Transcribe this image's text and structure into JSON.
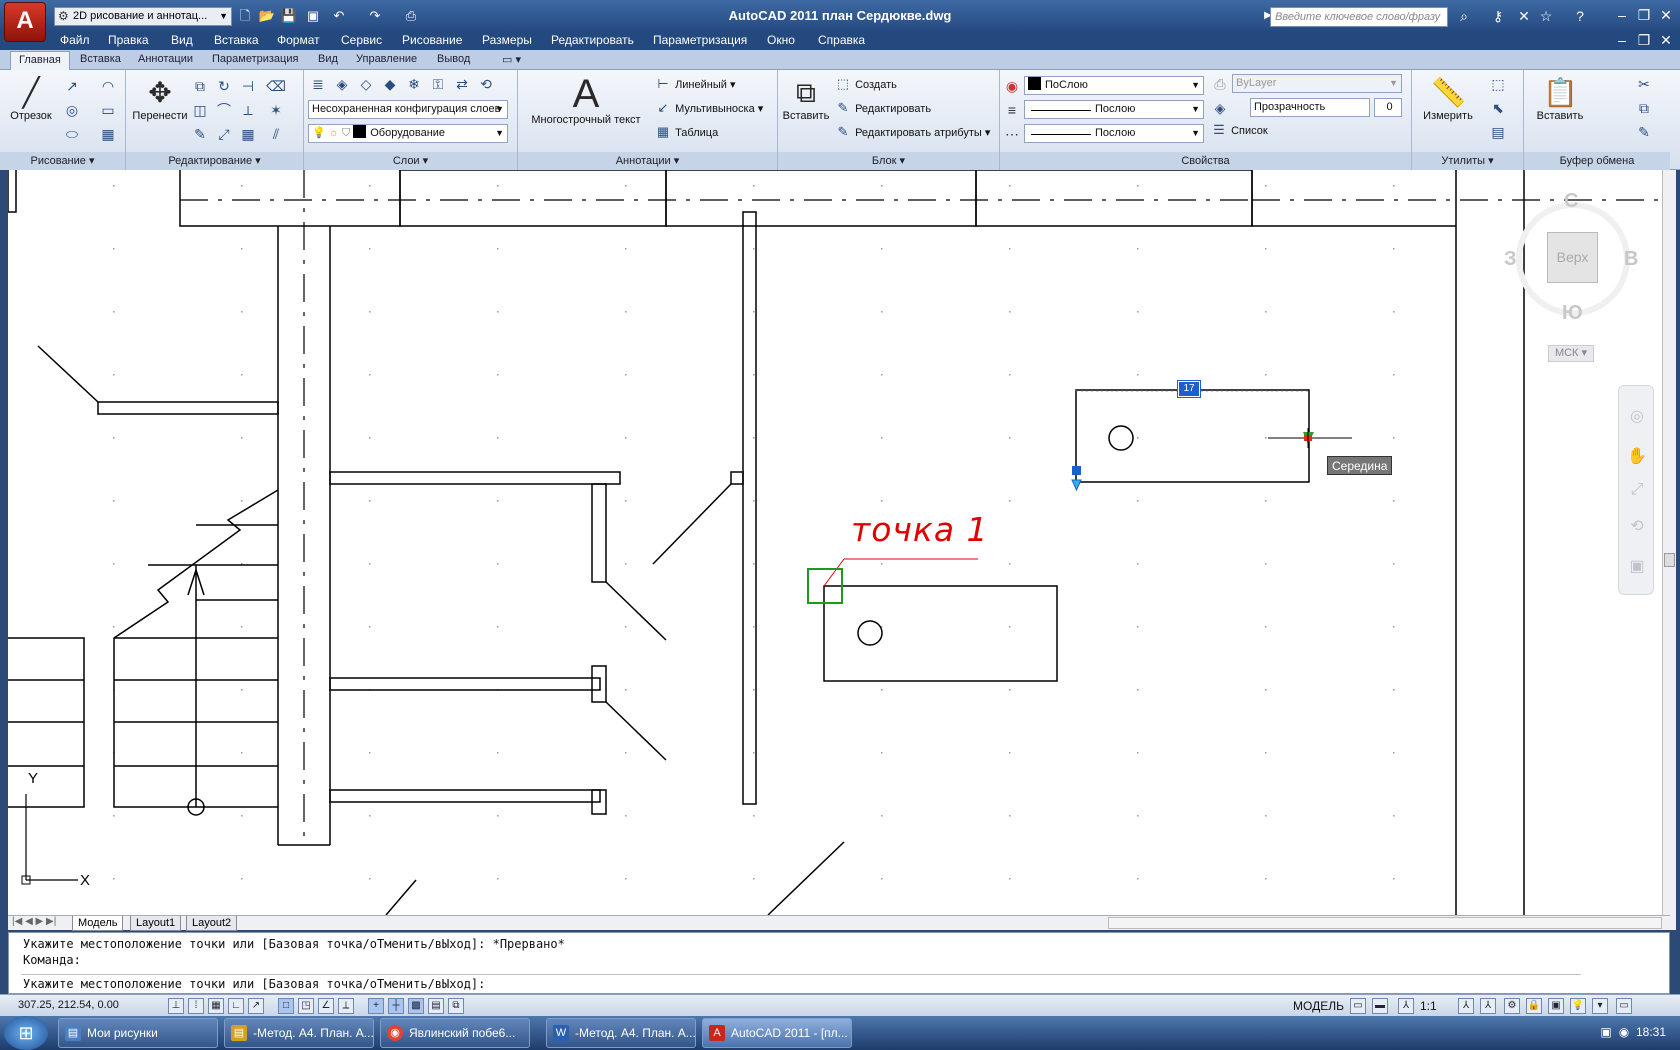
{
  "titlebar": {
    "app_button": "A",
    "workspace": "2D рисование и аннотац...",
    "title": "AutoCAD 2011    план Сердюкве.dwg",
    "search_placeholder": "Введите ключевое слово/фразу"
  },
  "menu": [
    "Файл",
    "Правка",
    "Вид",
    "Вставка",
    "Формат",
    "Сервис",
    "Рисование",
    "Размеры",
    "Редактировать",
    "Параметризация",
    "Окно",
    "Справка"
  ],
  "ribbon_tabs": [
    "Главная",
    "Вставка",
    "Аннотации",
    "Параметризация",
    "Вид",
    "Управление",
    "Вывод"
  ],
  "ribbon": {
    "draw": {
      "title": "Рисование",
      "line": "Отрезок"
    },
    "modify": {
      "title": "Редактирование",
      "move": "Перенести"
    },
    "layers": {
      "title": "Слои",
      "state": "Несохраненная конфигурация слоев",
      "current": "Оборудование"
    },
    "annotation": {
      "title": "Аннотации",
      "mtext": "Многострочный текст",
      "linear": "Линейный",
      "multileader": "Мультивыноска",
      "table": "Таблица"
    },
    "block": {
      "title": "Блок",
      "insert": "Вставить",
      "create": "Создать",
      "edit": "Редактировать",
      "edit_attrs": "Редактировать атрибуты"
    },
    "properties": {
      "title": "Свойства",
      "color": "ПоСлою",
      "linetype": "Послою",
      "lineweight": "Послою",
      "plotstyle": "ByLayer",
      "transparency": "Прозрачность",
      "transparency_val": "0",
      "list": "Список"
    },
    "utilities": {
      "title": "Утилиты",
      "measure": "Измерить"
    },
    "clipboard": {
      "title": "Буфер обмена",
      "paste": "Вставить"
    }
  },
  "canvas": {
    "point_label": "точка 1",
    "snap_tooltip": "Середина",
    "grip_value": "17",
    "viewcube": {
      "n": "С",
      "w": "З",
      "e": "В",
      "s": "Ю",
      "face": "Верх",
      "ucs": "МСК"
    },
    "ucs_x": "X",
    "ucs_y": "Y"
  },
  "layout_tabs": [
    "Модель",
    "Layout1",
    "Layout2"
  ],
  "command_line": {
    "line1": "Укажите местоположение точки или [Базовая точка/оТменить/вЫход]: *Прервано*",
    "line2": "Команда:",
    "line3": "Укажите местоположение точки или [Базовая точка/оТменить/вЫход]:"
  },
  "statusbar": {
    "coords": "307.25, 212.54, 0.00",
    "model": "МОДЕЛЬ",
    "scale": "1:1"
  },
  "taskbar": {
    "tasks": [
      "Мои рисунки",
      "-Метод. А4. План. А...",
      "Явлинский побе6...",
      "-Метод. А4. План. А...",
      "AutoCAD 2011 - [пл..."
    ],
    "clock": "18:31"
  }
}
